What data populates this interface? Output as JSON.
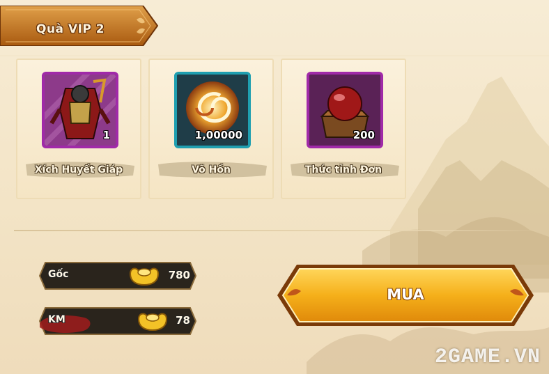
{
  "header": {
    "title": "Quà VIP 2"
  },
  "items": [
    {
      "name": "Xích Huyết Giáp",
      "quantity": "1",
      "icon": "armor-icon",
      "frame_color": "#a02aa8"
    },
    {
      "name": "Võ Hồn",
      "quantity": "1,00000",
      "icon": "soul-orb-icon",
      "frame_color": "#1f9fb0"
    },
    {
      "name": "Thức tỉnh Đơn",
      "quantity": "200",
      "icon": "awakening-pill-icon",
      "frame_color": "#a02aa8"
    }
  ],
  "prices": {
    "original": {
      "label": "Gốc",
      "value": "780",
      "icon": "gold-ingot-icon"
    },
    "discount": {
      "label": "KM",
      "value": "78",
      "icon": "gold-ingot-icon"
    }
  },
  "buy_button": {
    "label": "MUA"
  },
  "watermark": "2GAME.VN",
  "colors": {
    "ribbon": "#c9791e",
    "button": "#f3b21a",
    "background": "#f5e6c8"
  }
}
